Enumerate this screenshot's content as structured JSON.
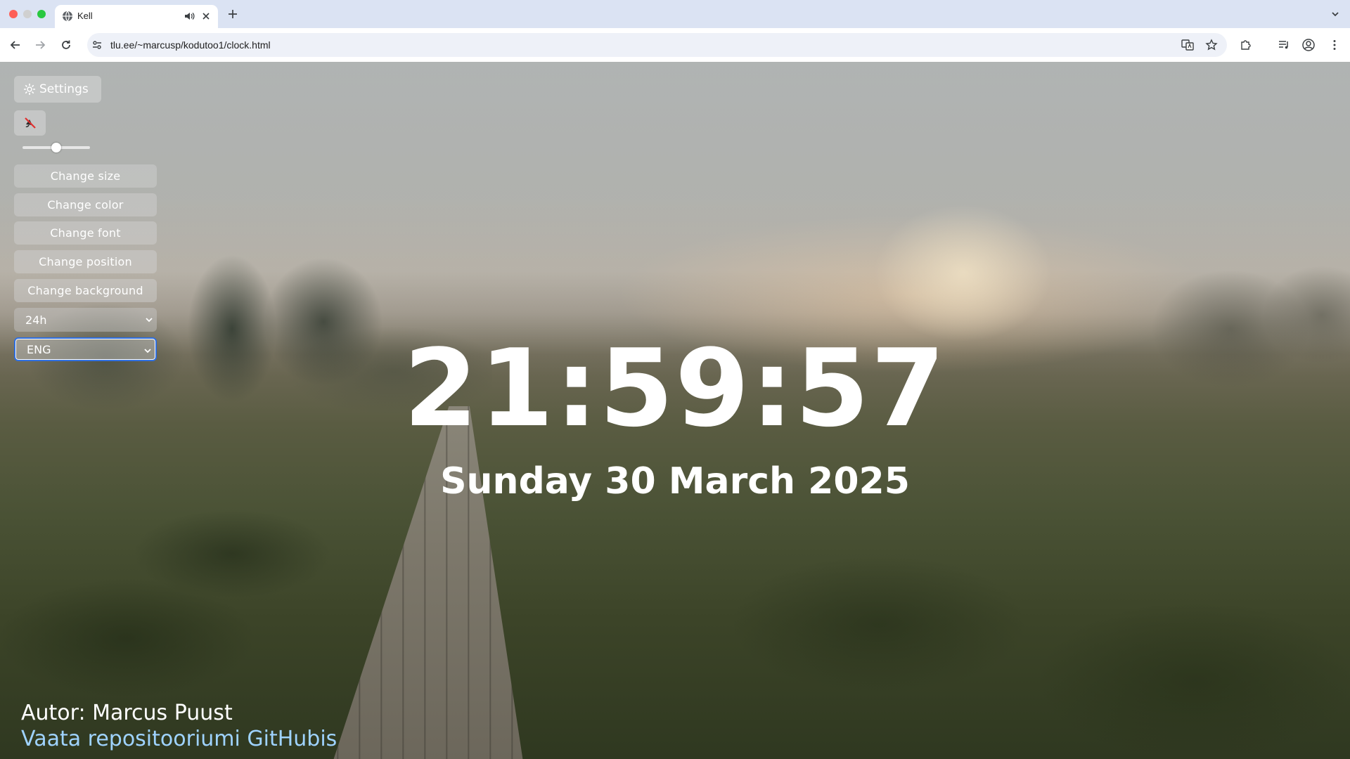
{
  "browser": {
    "tab": {
      "title": "Kell",
      "favicon": "globe-icon"
    },
    "url": "tlu.ee/~marcusp/kodutoo1/clock.html"
  },
  "colors": {
    "accent_focus": "#2f6fe0",
    "link": "#9fd3ff",
    "text": "#ffffff"
  },
  "settings": {
    "toggle_label": "Settings",
    "toggle_icon": "gear-icon",
    "mute_icon": "speaker-muted-icon",
    "volume_level": 0.5,
    "buttons": {
      "size": "Change size",
      "color": "Change color",
      "font": "Change font",
      "position": "Change position",
      "background": "Change background"
    },
    "format_select": {
      "value": "24h"
    },
    "language_select": {
      "value": "ENG"
    }
  },
  "clock": {
    "time": "21:59:57",
    "date": "Sunday 30 March 2025"
  },
  "footer": {
    "author": "Autor: Marcus Puust",
    "repo_link": "Vaata repositooriumi GitHubis"
  }
}
